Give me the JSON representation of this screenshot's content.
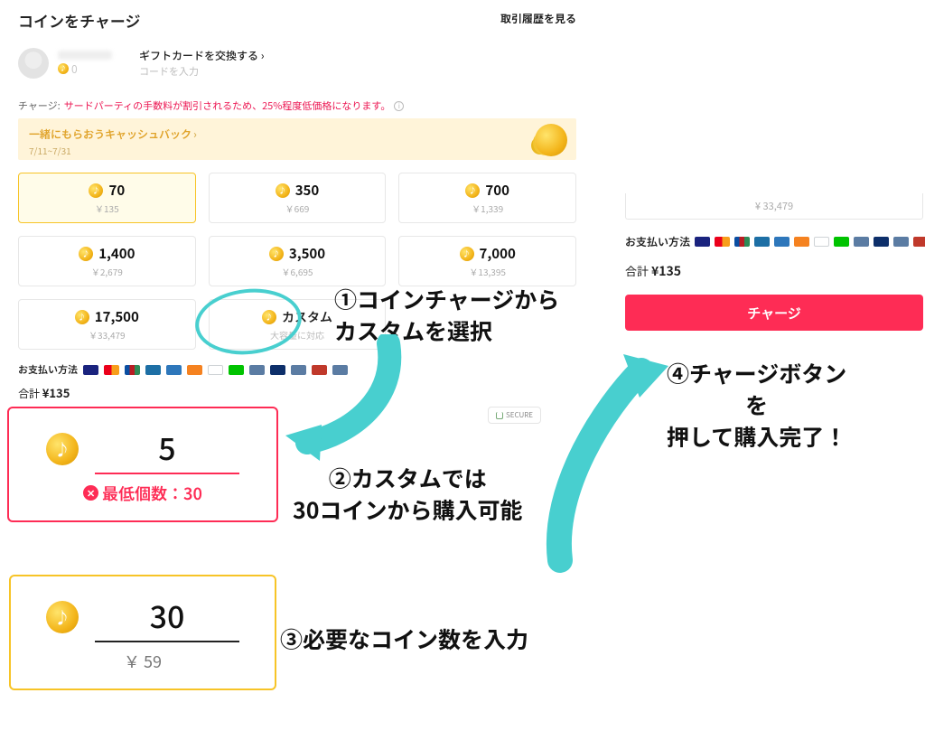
{
  "header": {
    "title": "コインをチャージ",
    "history": "取引履歴を見る"
  },
  "user": {
    "balance": "0",
    "gift_link": "ギフトカードを交換する ›",
    "gift_placeholder": "コードを入力"
  },
  "notice": {
    "prefix": "チャージ:",
    "red": "サードパーティの手数料が割引されるため、25%程度低価格になります。"
  },
  "promo": {
    "title": "一緒にもらおうキャッシュバック",
    "chev": "›",
    "dates": "7/11~7/31"
  },
  "options": [
    {
      "coins": "70",
      "price": "￥135",
      "selected": true
    },
    {
      "coins": "350",
      "price": "￥669"
    },
    {
      "coins": "700",
      "price": "￥1,339"
    },
    {
      "coins": "1,400",
      "price": "￥2,679"
    },
    {
      "coins": "3,500",
      "price": "￥6,695"
    },
    {
      "coins": "7,000",
      "price": "￥13,395"
    },
    {
      "coins": "17,500",
      "price": "￥33,479"
    }
  ],
  "custom": {
    "label": "カスタム",
    "sub": "大容量に対応"
  },
  "paylabel": "お支払い方法",
  "total": {
    "label": "合計",
    "value": "¥135"
  },
  "charge_btn": "チャージ",
  "secure": "SECURE",
  "right": {
    "prev_price": "¥ 33,479",
    "paylabel": "お支払い方法",
    "total_label": "合計",
    "total_value": "¥135",
    "btn": "チャージ"
  },
  "cb_err": {
    "value": "5",
    "msg": "最低個数：30"
  },
  "cb_ok": {
    "value": "30",
    "price": "￥ 59"
  },
  "coin_glyph": "♪",
  "anno": {
    "a1": "①コインチャージから\nカスタムを選択",
    "a2": "②カスタムでは\n30コインから購入可能",
    "a3": "③必要なコイン数を入力",
    "a4": "④チャージボタン\nを\n押して購入完了！"
  }
}
